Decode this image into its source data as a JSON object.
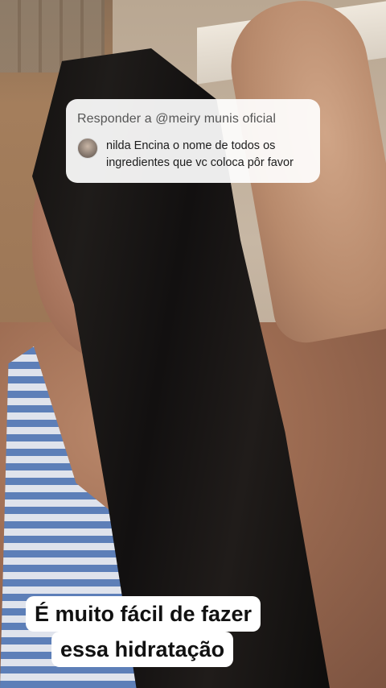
{
  "reply_card": {
    "header": "Responder a @meiry munis oficial",
    "comment": "nilda Encina o nome de todos os ingredientes que vc coloca pôr favor"
  },
  "caption": {
    "line1": "É muito fácil de fazer",
    "line2": "essa hidratação"
  }
}
